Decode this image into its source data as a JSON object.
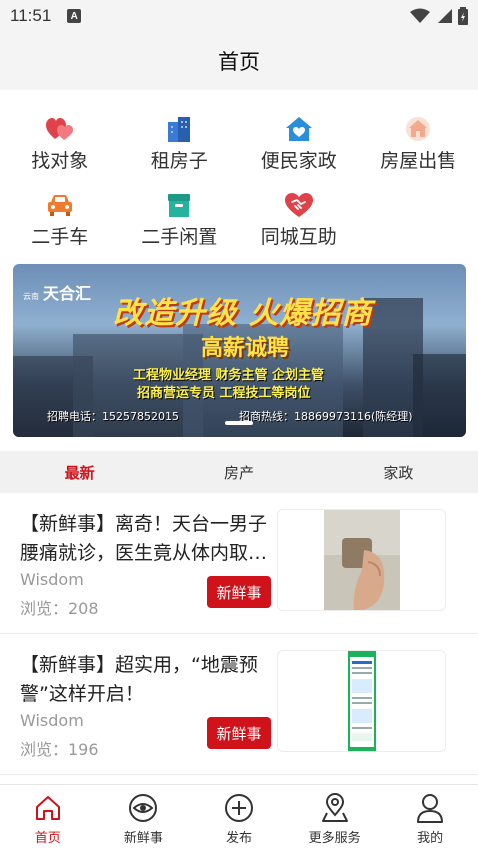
{
  "status": {
    "time": "11:51",
    "notif": "A"
  },
  "header": {
    "title": "首页"
  },
  "grid": [
    {
      "label": "找对象",
      "icon": "heart-couple-icon",
      "color": "#e0424a"
    },
    {
      "label": "租房子",
      "icon": "building-icon",
      "color": "#3a7bd5"
    },
    {
      "label": "便民家政",
      "icon": "house-heart-icon",
      "color": "#2a8fd8"
    },
    {
      "label": "房屋出售",
      "icon": "house-sale-icon",
      "color": "#f3a98b"
    },
    {
      "label": "二手车",
      "icon": "car-icon",
      "color": "#f07a2d"
    },
    {
      "label": "二手闲置",
      "icon": "box-icon",
      "color": "#25b39e"
    },
    {
      "label": "同城互助",
      "icon": "handshake-heart-icon",
      "color": "#e0424a"
    }
  ],
  "banner": {
    "logo_small": "云南",
    "logo": "天合汇",
    "headline": "改造升级 火爆招商",
    "sub": "高薪诚聘",
    "line1": "工程物业经理 财务主管 企划主管",
    "line2": "招商营运专员 工程技工等岗位",
    "contact": "招聘电话：15257852015",
    "hotline": "招商热线：18869973116(陈经理)"
  },
  "tabs": [
    {
      "label": "最新",
      "active": true
    },
    {
      "label": "房产",
      "active": false
    },
    {
      "label": "家政",
      "active": false
    }
  ],
  "feed": [
    {
      "title": "【新鲜事】离奇！天台一男子腰痛就诊，医生竟从体内取出…",
      "author": "Wisdom",
      "views": "浏览：208",
      "tag": "新鲜事"
    },
    {
      "title": "【新鲜事】超实用，“地震预警”这样开启！",
      "author": "Wisdom",
      "views": "浏览：196",
      "tag": "新鲜事"
    }
  ],
  "nav": [
    {
      "label": "首页",
      "icon": "home-icon",
      "active": true
    },
    {
      "label": "新鲜事",
      "icon": "eye-icon",
      "active": false
    },
    {
      "label": "发布",
      "icon": "plus-circle-icon",
      "active": false
    },
    {
      "label": "更多服务",
      "icon": "location-pin-icon",
      "active": false
    },
    {
      "label": "我的",
      "icon": "user-icon",
      "active": false
    }
  ],
  "colors": {
    "accent": "#d0121b",
    "bar_bg": "#f4f4f4"
  }
}
